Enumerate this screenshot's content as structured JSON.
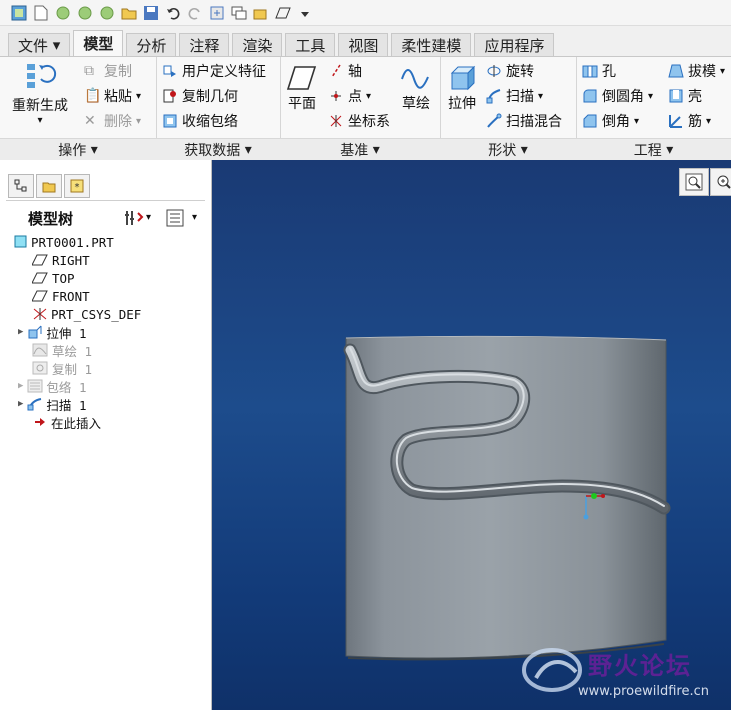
{
  "menu_tabs": [
    "文件",
    "模型",
    "分析",
    "注释",
    "渲染",
    "工具",
    "视图",
    "柔性建模",
    "应用程序"
  ],
  "ribbon": {
    "operations": {
      "regen": "重新生成",
      "copy": "复制",
      "paste": "粘贴",
      "delete": "删除",
      "footer": "操作"
    },
    "get_data": {
      "udf": "用户定义特征",
      "copy_geom": "复制几何",
      "shrinkwrap": "收缩包络",
      "footer": "获取数据"
    },
    "datum": {
      "plane": "平面",
      "axis": "轴",
      "point": "点",
      "csys": "坐标系",
      "sketch": "草绘",
      "footer": "基准"
    },
    "shapes": {
      "extrude": "拉伸",
      "revolve": "旋转",
      "sweep": "扫描",
      "swept_blend": "扫描混合",
      "footer": "形状"
    },
    "engineering": {
      "hole": "孔",
      "round": "倒圆角",
      "chamfer": "倒角",
      "draft": "拔模",
      "shell": "壳",
      "rib": "筋",
      "footer": "工程"
    }
  },
  "model_tree": {
    "title": "模型树",
    "items": [
      {
        "label": "PRT0001.PRT"
      },
      {
        "label": "RIGHT"
      },
      {
        "label": "TOP"
      },
      {
        "label": "FRONT"
      },
      {
        "label": "PRT_CSYS_DEF"
      },
      {
        "label": "拉伸 1"
      },
      {
        "label": "草绘 1"
      },
      {
        "label": "复制 1"
      },
      {
        "label": "包络 1"
      },
      {
        "label": "扫描 1"
      },
      {
        "label": "在此插入"
      }
    ]
  },
  "watermark": {
    "title": "野火论坛",
    "url": "www.proewildfire.cn"
  },
  "colors": {
    "viewport_top": "#1a3a74",
    "viewport_bottom": "#0f3169",
    "model": "#8c949c",
    "insert_arrow": "#c0161a"
  }
}
